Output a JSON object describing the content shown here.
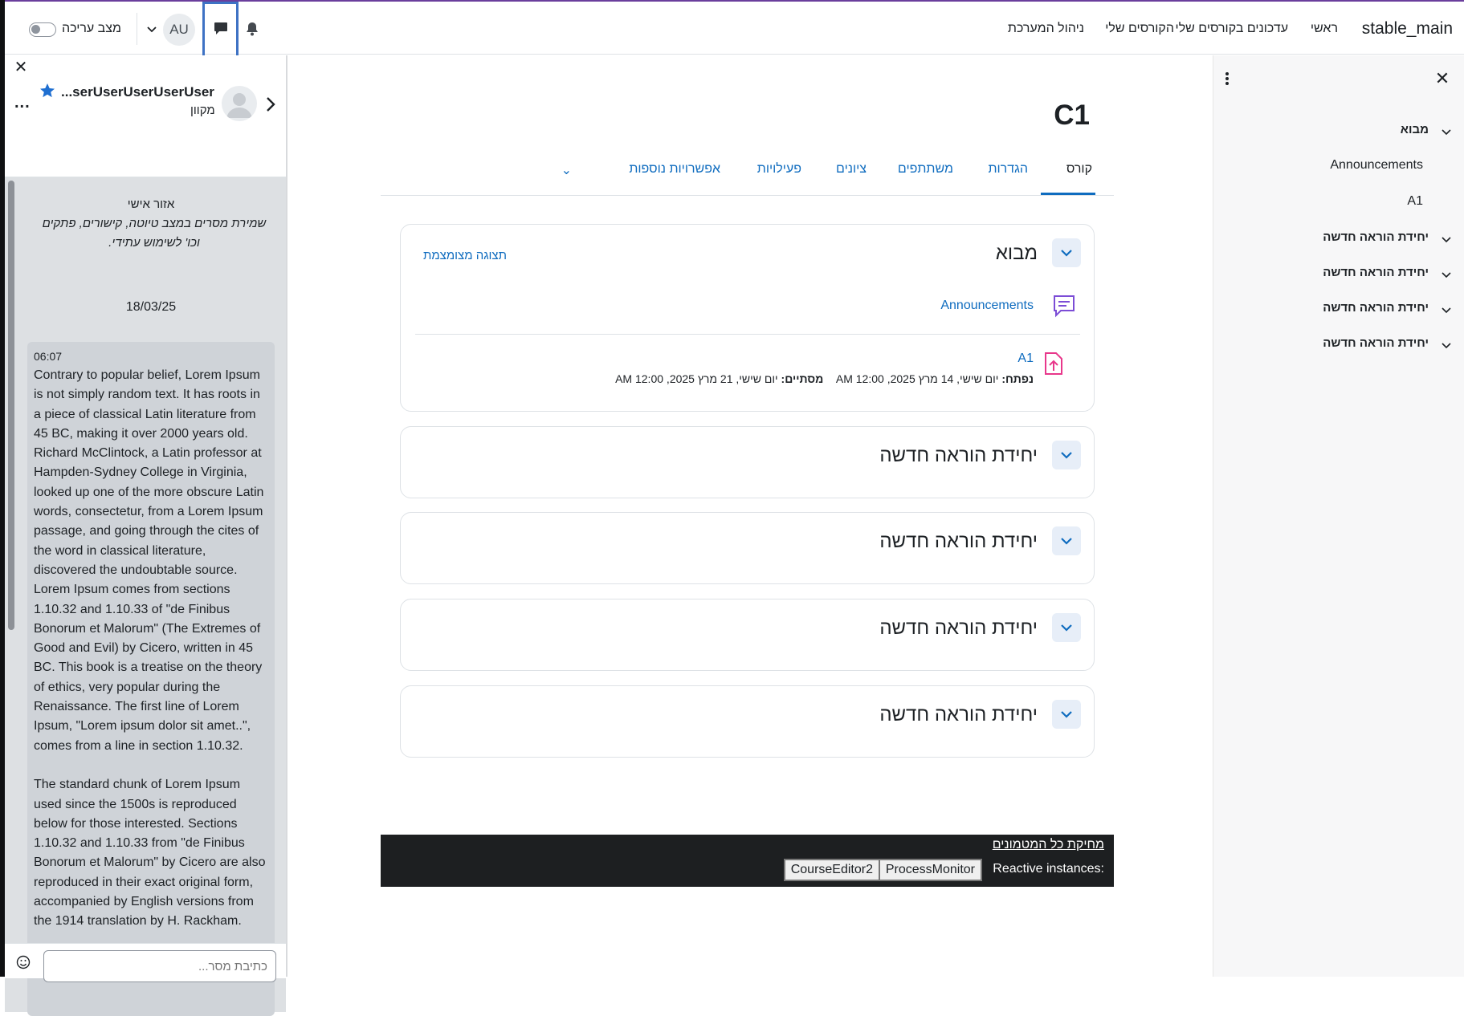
{
  "navbar": {
    "site_name": "stable_main",
    "links": [
      "ראשי",
      "עדכונים בקורסים שלי",
      "הקורסים שלי",
      "ניהול המערכת"
    ],
    "user_initials": "AU",
    "edit_mode_label": "מצב עריכה"
  },
  "drawer": {
    "contact_name": "...serUserUserUserUser",
    "contact_status": "מקוון",
    "more_label": "...",
    "private_title": "אזור אישי",
    "private_desc": "שמירת מסרים במצב טיוטה, קישורים, פתקים וכו' לשימוש עתידי.",
    "date": "18/03/25",
    "message_time": "06:07",
    "message_text": "Contrary to popular belief, Lorem Ipsum is not simply random text. It has roots in a piece of classical Latin literature from 45 BC, making it over 2000 years old. Richard McClintock, a Latin professor at Hampden-Sydney College in Virginia, looked up one of the more obscure Latin words, consectetur, from a Lorem Ipsum passage, and going through the cites of the word in classical literature, discovered the undoubtable source. Lorem Ipsum comes from sections 1.10.32 and 1.10.33 of \"de Finibus Bonorum et Malorum\" (The Extremes of Good and Evil) by Cicero, written in 45 BC. This book is a treatise on the theory of ethics, very popular during the Renaissance. The first line of Lorem Ipsum, \"Lorem ipsum dolor sit amet..\", comes from a line in section 1.10.32.\n\nThe standard chunk of Lorem Ipsum used since the 1500s is reproduced below for those interested. Sections 1.10.32 and 1.10.33 from \"de Finibus Bonorum et Malorum\" by Cicero are also reproduced in their exact original form, accompanied by English versions from the 1914 translation by H. Rackham.",
    "input_placeholder": "כתיבת מסר..."
  },
  "course": {
    "title": "C1",
    "tabs": [
      "קורס",
      "הגדרות",
      "משתתפים",
      "ציונים",
      "פעילויות",
      "אפשרויות נוספות"
    ],
    "sections": [
      {
        "title": "מבוא",
        "collapse_label": "תצוגה מצומצמת",
        "activities": [
          {
            "name": "Announcements",
            "icon": "forum-icon"
          },
          {
            "name": "A1",
            "icon": "assignment-upload-icon",
            "opened_label": "נפתח:",
            "opened_value": "יום שישי, 14 מרץ 2025, 12:00 AM",
            "due_label": "מסתיים:",
            "due_value": "יום שישי, 21 מרץ 2025, 12:00 AM"
          }
        ]
      },
      {
        "title": "יחידת הוראה חדשה"
      },
      {
        "title": "יחידת הוראה חדשה"
      },
      {
        "title": "יחידת הוראה חדשה"
      },
      {
        "title": "יחידת הוראה חדשה"
      }
    ]
  },
  "debug": {
    "purge_label": "מחיקת כל המטמונים",
    "reactive_label": "Reactive instances:",
    "instances": [
      "ProcessMonitor",
      "CourseEditor2"
    ]
  },
  "index": {
    "items": [
      {
        "label": "מבוא",
        "subitems": [
          "Announcements",
          "A1"
        ]
      },
      {
        "label": "יחידת הוראה חדשה"
      },
      {
        "label": "יחידת הוראה חדשה"
      },
      {
        "label": "יחידת הוראה חדשה"
      },
      {
        "label": "יחידת הוראה חדשה"
      }
    ]
  },
  "colors": {
    "accent": "#0f6cbf",
    "highlight_border": "#3e72c4",
    "debug_bg": "#1d1f21"
  }
}
